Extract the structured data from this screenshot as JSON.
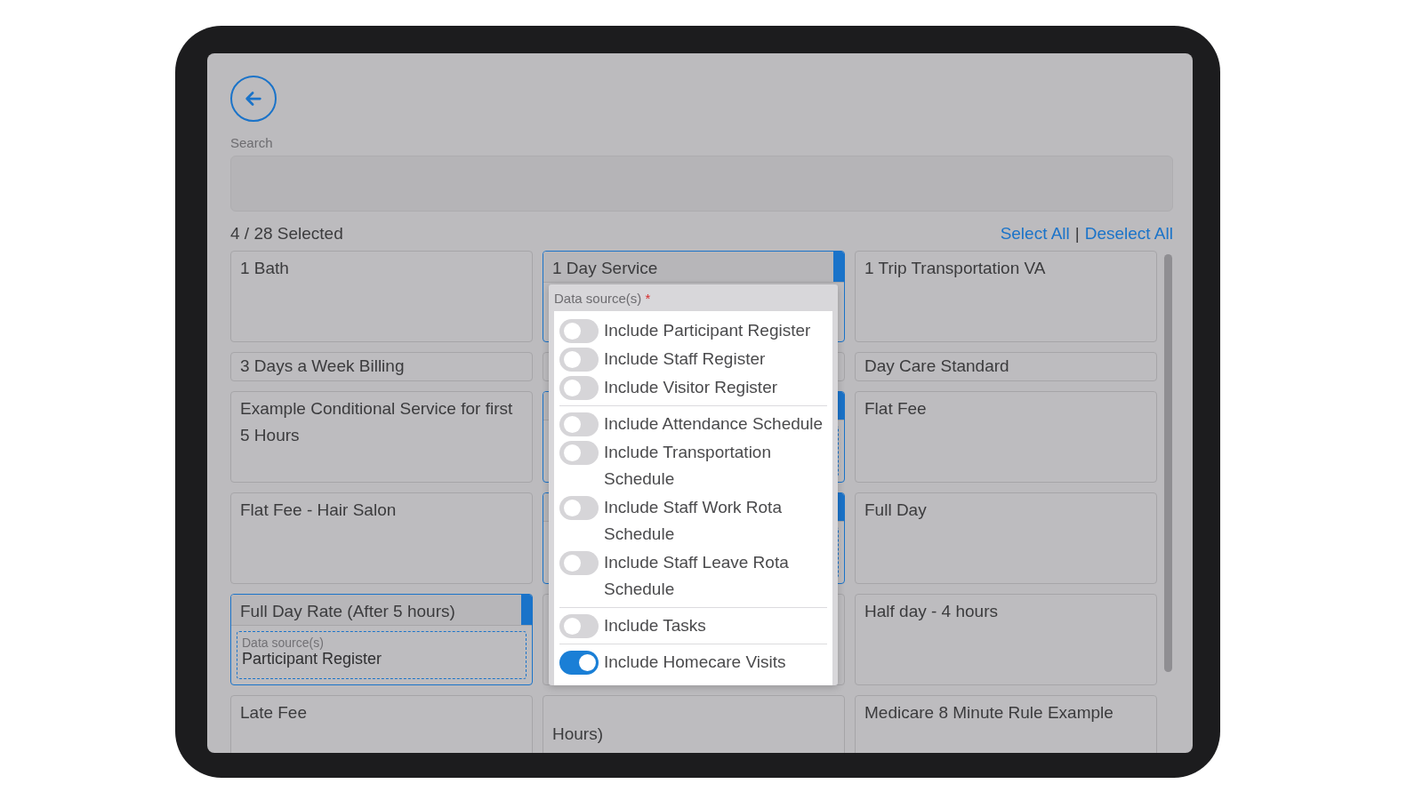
{
  "search": {
    "label": "Search"
  },
  "selection": {
    "count": "4 / 28 Selected",
    "select_all": "Select All",
    "separator": "|",
    "deselect_all": "Deselect All"
  },
  "cards": [
    {
      "title": "1 Bath",
      "selected": false,
      "kind": "tall"
    },
    {
      "title": "1 Day Service",
      "selected": true,
      "kind": "tall"
    },
    {
      "title": "1 Trip Transportation VA",
      "selected": false,
      "kind": "tall"
    },
    {
      "title": "3 Days a Week Billing",
      "selected": false,
      "kind": "compact"
    },
    {
      "selected": false,
      "kind": "compact"
    },
    {
      "title": "Day Care Standard",
      "selected": false,
      "kind": "compact"
    },
    {
      "title": "Example Conditional Service for first 5 Hours",
      "selected": false,
      "kind": "tall"
    },
    {
      "selected": true,
      "kind": "tall",
      "detail": true
    },
    {
      "title": "Flat Fee",
      "selected": false,
      "kind": "tall"
    },
    {
      "title": "Flat Fee - Hair Salon",
      "selected": false,
      "kind": "tall"
    },
    {
      "selected": true,
      "kind": "tall",
      "detail": true
    },
    {
      "title": "Full Day",
      "selected": false,
      "kind": "tall"
    },
    {
      "title": "Full Day Rate (After 5 hours)",
      "selected": true,
      "kind": "tall",
      "data_source": {
        "label": "Data source(s)",
        "value": "Participant Register"
      }
    },
    {
      "selected": false,
      "kind": "tall"
    },
    {
      "title": "Half day - 4 hours",
      "selected": false,
      "kind": "tall"
    },
    {
      "title": "Late Fee",
      "selected": false,
      "kind": "tall"
    },
    {
      "tail": "Hours)",
      "selected": false,
      "kind": "tall"
    },
    {
      "title": "Medicare 8 Minute Rule Example",
      "selected": false,
      "kind": "tall"
    }
  ],
  "popup": {
    "label": "Data source(s)",
    "required": "*",
    "groups": [
      [
        {
          "label": "Include Participant Register",
          "on": false
        },
        {
          "label": "Include Staff Register",
          "on": false
        },
        {
          "label": "Include Visitor Register",
          "on": false
        }
      ],
      [
        {
          "label": "Include Attendance Schedule",
          "on": false
        },
        {
          "label": "Include Transportation Schedule",
          "on": false
        },
        {
          "label": "Include Staff Work Rota Schedule",
          "on": false
        },
        {
          "label": "Include Staff Leave Rota Schedule",
          "on": false
        }
      ],
      [
        {
          "label": "Include Tasks",
          "on": false
        }
      ],
      [
        {
          "label": "Include Homecare Visits",
          "on": true
        }
      ]
    ]
  }
}
